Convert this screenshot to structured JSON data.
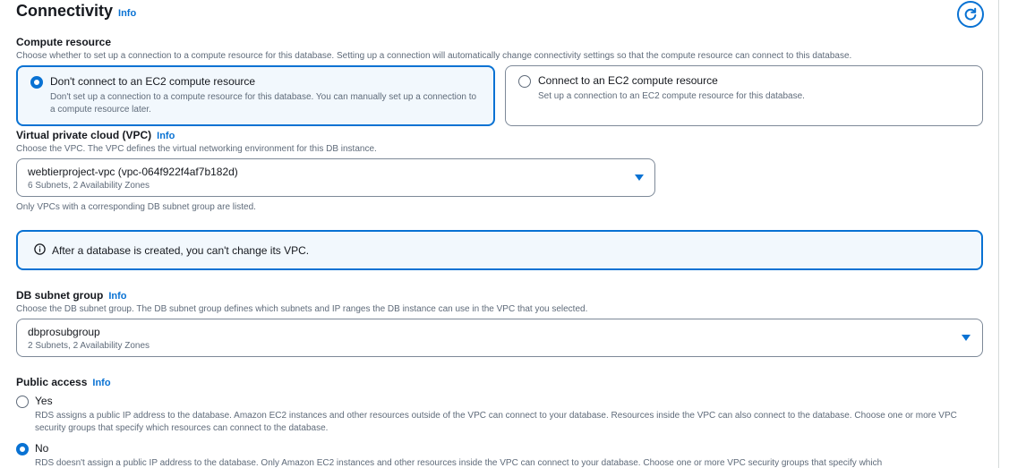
{
  "section": {
    "title": "Connectivity",
    "info": "Info"
  },
  "compute": {
    "label": "Compute resource",
    "description": "Choose whether to set up a connection to a compute resource for this database. Setting up a connection will automatically change connectivity settings so that the compute resource can connect to this database.",
    "options": [
      {
        "title": "Don't connect to an EC2 compute resource",
        "description": "Don't set up a connection to a compute resource for this database. You can manually set up a connection to a compute resource later.",
        "selected": true
      },
      {
        "title": "Connect to an EC2 compute resource",
        "description": "Set up a connection to an EC2 compute resource for this database.",
        "selected": false
      }
    ]
  },
  "vpc": {
    "label": "Virtual private cloud (VPC)",
    "info": "Info",
    "description": "Choose the VPC. The VPC defines the virtual networking environment for this DB instance.",
    "value": "webtierproject-vpc (vpc-064f922f4af7b182d)",
    "sub": "6 Subnets, 2 Availability Zones",
    "hint": "Only VPCs with a corresponding DB subnet group are listed."
  },
  "alert": {
    "text": "After a database is created, you can't change its VPC."
  },
  "subnet": {
    "label": "DB subnet group",
    "info": "Info",
    "description": "Choose the DB subnet group. The DB subnet group defines which subnets and IP ranges the DB instance can use in the VPC that you selected.",
    "value": "dbprosubgroup",
    "sub": "2 Subnets, 2 Availability Zones"
  },
  "public_access": {
    "label": "Public access",
    "info": "Info",
    "options": [
      {
        "label": "Yes",
        "description": "RDS assigns a public IP address to the database. Amazon EC2 instances and other resources outside of the VPC can connect to your database. Resources inside the VPC can also connect to the database. Choose one or more VPC security groups that specify which resources can connect to the database.",
        "selected": false
      },
      {
        "label": "No",
        "description": "RDS doesn't assign a public IP address to the database. Only Amazon EC2 instances and other resources inside the VPC can connect to your database. Choose one or more VPC security groups that specify which",
        "selected": true
      }
    ]
  },
  "icons": {
    "refresh": "refresh-icon",
    "info_circle": "info-circle-icon",
    "caret": "caret-down-icon"
  },
  "colors": {
    "accent": "#0972d3",
    "text": "#16191f",
    "muted": "#5f6b7a",
    "border": "#7d8998",
    "selected_bg": "#f2f8fd"
  }
}
